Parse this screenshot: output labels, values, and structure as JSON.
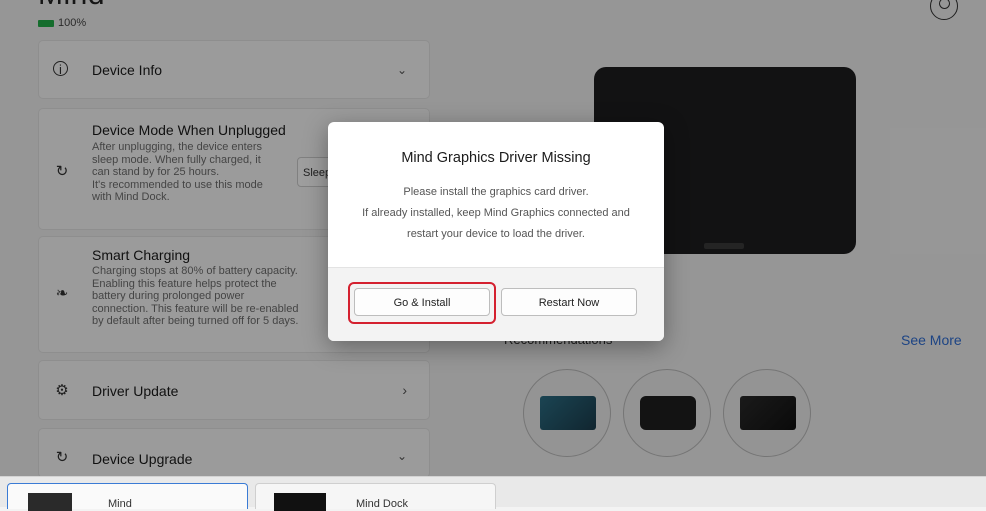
{
  "header": {
    "title": "Mind",
    "battery_text": "100%"
  },
  "cards": {
    "device_info": {
      "title": "Device Info"
    },
    "device_mode": {
      "title": "Device Mode When Unplugged",
      "desc_lines": [
        "After unplugging, the device enters",
        "sleep mode. When fully charged, it",
        "can stand by for 25 hours.",
        "It's recommended to use this mode",
        "with Mind Dock."
      ],
      "select_value": "Sleep"
    },
    "smart_charging": {
      "title": "Smart Charging",
      "desc_lines": [
        "Charging stops at 80% of battery capacity.",
        "Enabling this feature helps protect the",
        "battery during prolonged power",
        "connection. This feature will be re-enabled",
        "by default after being turned off for 5 days."
      ]
    },
    "driver_update": {
      "title": "Driver Update"
    },
    "device_upgrade": {
      "title": "Device Upgrade"
    }
  },
  "recommendations": {
    "label": "Recommendations",
    "see_more": "See More"
  },
  "taskbar": {
    "tabs": [
      {
        "label": "Mind"
      },
      {
        "label": "Mind Dock"
      }
    ]
  },
  "dialog": {
    "title": "Mind Graphics Driver Missing",
    "message_lines": [
      "Please install the graphics card driver.",
      "If already installed, keep Mind Graphics connected and",
      "restart your device to load the driver."
    ],
    "primary_button": "Go & Install",
    "secondary_button": "Restart Now"
  },
  "colors": {
    "battery": "#22b04a",
    "link": "#2f6fd6",
    "highlight": "#d4202f"
  }
}
